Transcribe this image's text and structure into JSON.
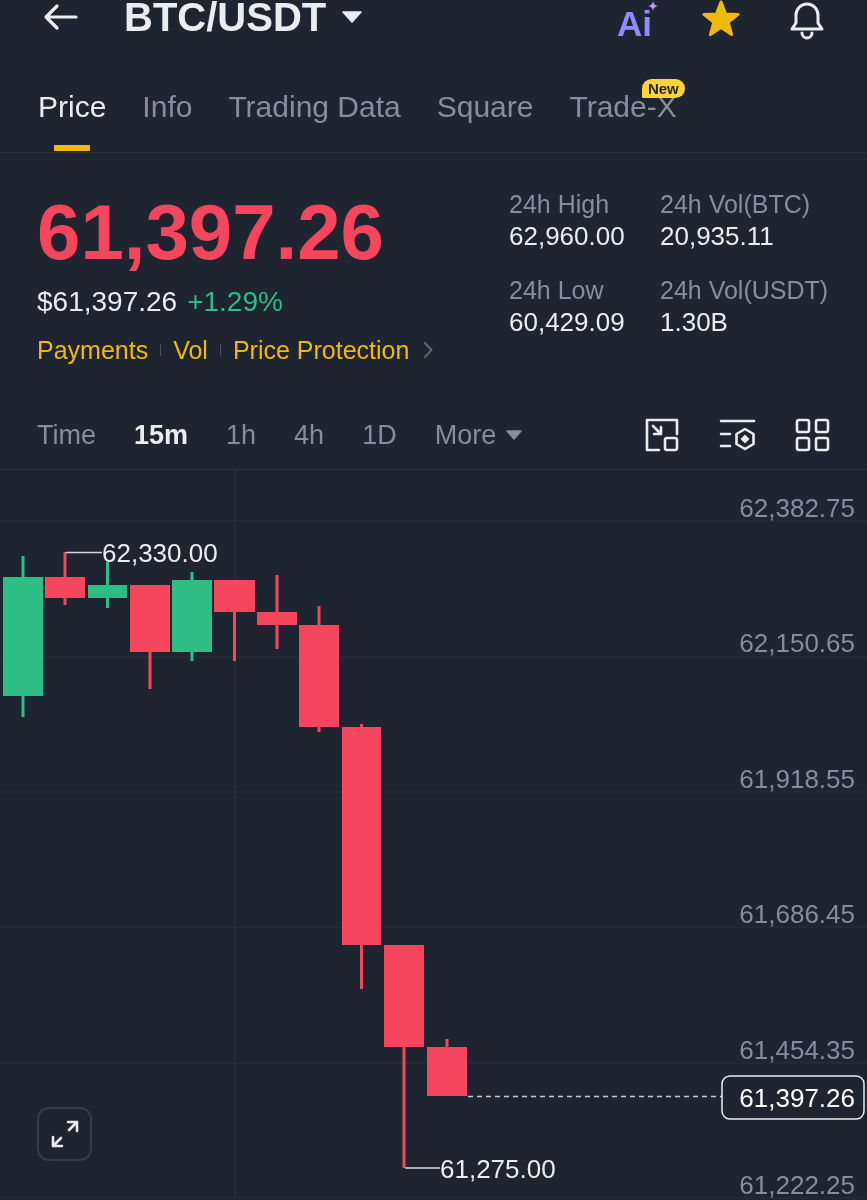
{
  "header": {
    "title": "BTC/USDT",
    "ai_label": "Ai"
  },
  "tabs": [
    {
      "label": "Price",
      "selected": true
    },
    {
      "label": "Info",
      "selected": false
    },
    {
      "label": "Trading Data",
      "selected": false
    },
    {
      "label": "Square",
      "selected": false
    },
    {
      "label": "Trade-X",
      "selected": false,
      "badge": "New"
    }
  ],
  "ticker": {
    "price": "61,397.26",
    "price_rising": false,
    "fiat_price": "$61,397.26",
    "change": "+1.29%",
    "change_rising": true,
    "links": [
      "Payments",
      "Vol",
      "Price Protection"
    ]
  },
  "stats": [
    {
      "label": "24h High",
      "value": "62,960.00"
    },
    {
      "label": "24h Vol(BTC)",
      "value": "20,935.11"
    },
    {
      "label": "24h Low",
      "value": "60,429.09"
    },
    {
      "label": "24h Vol(USDT)",
      "value": "1.30B"
    }
  ],
  "intervals": [
    {
      "kind": "option",
      "label": "Time",
      "selected": false
    },
    {
      "kind": "option",
      "label": "15m",
      "selected": true
    },
    {
      "kind": "option",
      "label": "1h",
      "selected": false
    },
    {
      "kind": "option",
      "label": "4h",
      "selected": false
    },
    {
      "kind": "option",
      "label": "1D",
      "selected": false
    },
    {
      "kind": "menu",
      "label": "More",
      "selected": false
    }
  ],
  "chart": {
    "price_axis": [
      "62,382.75",
      "62,150.65",
      "61,918.55",
      "61,686.45",
      "61,454.35",
      "61,222.25"
    ],
    "high_marker": "62,330.00",
    "low_marker": "61,275.00",
    "last_price": "61,397.26"
  }
}
